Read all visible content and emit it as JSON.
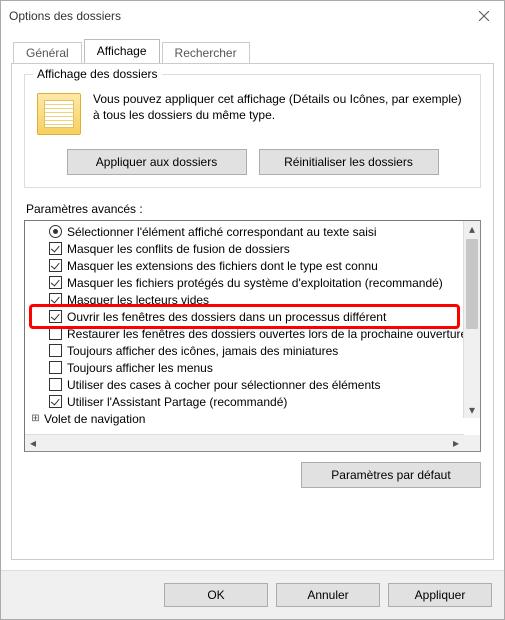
{
  "window": {
    "title": "Options des dossiers"
  },
  "tabs": {
    "general": "Général",
    "display": "Affichage",
    "search": "Rechercher"
  },
  "group": {
    "title": "Affichage des dossiers",
    "text": "Vous pouvez appliquer cet affichage (Détails ou Icônes, par exemple) à tous les dossiers du même type.",
    "apply": "Appliquer aux dossiers",
    "reset": "Réinitialiser les dossiers"
  },
  "advanced_label": "Paramètres avancés :",
  "items": [
    {
      "kind": "radio",
      "checked": true,
      "label": "Sélectionner l'élément affiché correspondant au texte saisi"
    },
    {
      "kind": "checkbox",
      "checked": true,
      "label": "Masquer les conflits de fusion de dossiers"
    },
    {
      "kind": "checkbox",
      "checked": true,
      "label": "Masquer les extensions des fichiers dont le type est connu"
    },
    {
      "kind": "checkbox",
      "checked": true,
      "label": "Masquer les fichiers protégés du système d'exploitation (recommandé)"
    },
    {
      "kind": "checkbox",
      "checked": true,
      "label": "Masquer les lecteurs vides"
    },
    {
      "kind": "checkbox",
      "checked": true,
      "label": "Ouvrir les fenêtres des dossiers dans un processus différent",
      "highlight": true
    },
    {
      "kind": "checkbox",
      "checked": false,
      "label": "Restaurer les fenêtres des dossiers ouvertes lors de la prochaine ouverture de session"
    },
    {
      "kind": "checkbox",
      "checked": false,
      "label": "Toujours afficher des icônes, jamais des miniatures"
    },
    {
      "kind": "checkbox",
      "checked": false,
      "label": "Toujours afficher les menus"
    },
    {
      "kind": "checkbox",
      "checked": false,
      "label": "Utiliser des cases à cocher pour sélectionner des éléments"
    },
    {
      "kind": "checkbox",
      "checked": true,
      "label": "Utiliser l'Assistant Partage (recommandé)"
    },
    {
      "kind": "node",
      "label": "Volet de navigation"
    }
  ],
  "defaults_btn": "Paramètres par défaut",
  "buttons": {
    "ok": "OK",
    "cancel": "Annuler",
    "apply": "Appliquer"
  }
}
